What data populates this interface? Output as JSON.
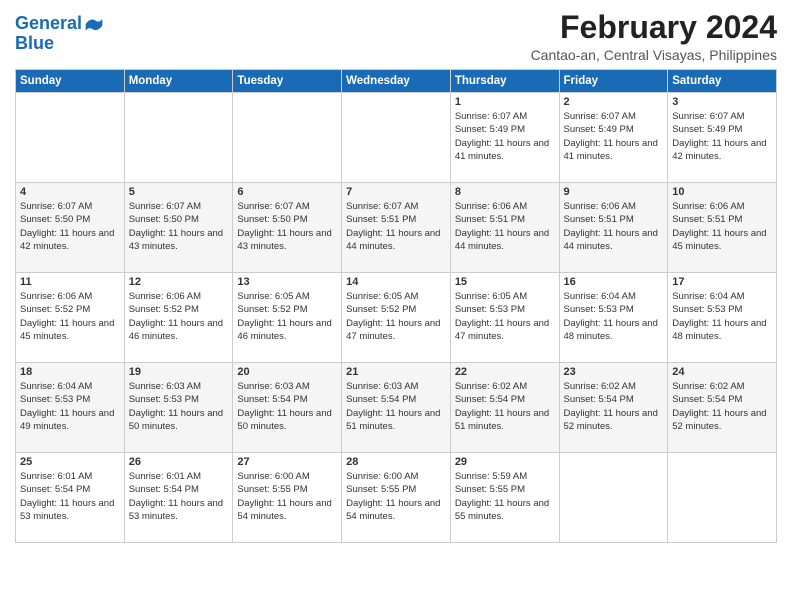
{
  "logo": {
    "line1": "General",
    "line2": "Blue"
  },
  "title": "February 2024",
  "subtitle": "Cantao-an, Central Visayas, Philippines",
  "days_header": [
    "Sunday",
    "Monday",
    "Tuesday",
    "Wednesday",
    "Thursday",
    "Friday",
    "Saturday"
  ],
  "weeks": [
    [
      {
        "day": "",
        "info": ""
      },
      {
        "day": "",
        "info": ""
      },
      {
        "day": "",
        "info": ""
      },
      {
        "day": "",
        "info": ""
      },
      {
        "day": "1",
        "info": "Sunrise: 6:07 AM\nSunset: 5:49 PM\nDaylight: 11 hours and 41 minutes."
      },
      {
        "day": "2",
        "info": "Sunrise: 6:07 AM\nSunset: 5:49 PM\nDaylight: 11 hours and 41 minutes."
      },
      {
        "day": "3",
        "info": "Sunrise: 6:07 AM\nSunset: 5:49 PM\nDaylight: 11 hours and 42 minutes."
      }
    ],
    [
      {
        "day": "4",
        "info": "Sunrise: 6:07 AM\nSunset: 5:50 PM\nDaylight: 11 hours and 42 minutes."
      },
      {
        "day": "5",
        "info": "Sunrise: 6:07 AM\nSunset: 5:50 PM\nDaylight: 11 hours and 43 minutes."
      },
      {
        "day": "6",
        "info": "Sunrise: 6:07 AM\nSunset: 5:50 PM\nDaylight: 11 hours and 43 minutes."
      },
      {
        "day": "7",
        "info": "Sunrise: 6:07 AM\nSunset: 5:51 PM\nDaylight: 11 hours and 44 minutes."
      },
      {
        "day": "8",
        "info": "Sunrise: 6:06 AM\nSunset: 5:51 PM\nDaylight: 11 hours and 44 minutes."
      },
      {
        "day": "9",
        "info": "Sunrise: 6:06 AM\nSunset: 5:51 PM\nDaylight: 11 hours and 44 minutes."
      },
      {
        "day": "10",
        "info": "Sunrise: 6:06 AM\nSunset: 5:51 PM\nDaylight: 11 hours and 45 minutes."
      }
    ],
    [
      {
        "day": "11",
        "info": "Sunrise: 6:06 AM\nSunset: 5:52 PM\nDaylight: 11 hours and 45 minutes."
      },
      {
        "day": "12",
        "info": "Sunrise: 6:06 AM\nSunset: 5:52 PM\nDaylight: 11 hours and 46 minutes."
      },
      {
        "day": "13",
        "info": "Sunrise: 6:05 AM\nSunset: 5:52 PM\nDaylight: 11 hours and 46 minutes."
      },
      {
        "day": "14",
        "info": "Sunrise: 6:05 AM\nSunset: 5:52 PM\nDaylight: 11 hours and 47 minutes."
      },
      {
        "day": "15",
        "info": "Sunrise: 6:05 AM\nSunset: 5:53 PM\nDaylight: 11 hours and 47 minutes."
      },
      {
        "day": "16",
        "info": "Sunrise: 6:04 AM\nSunset: 5:53 PM\nDaylight: 11 hours and 48 minutes."
      },
      {
        "day": "17",
        "info": "Sunrise: 6:04 AM\nSunset: 5:53 PM\nDaylight: 11 hours and 48 minutes."
      }
    ],
    [
      {
        "day": "18",
        "info": "Sunrise: 6:04 AM\nSunset: 5:53 PM\nDaylight: 11 hours and 49 minutes."
      },
      {
        "day": "19",
        "info": "Sunrise: 6:03 AM\nSunset: 5:53 PM\nDaylight: 11 hours and 50 minutes."
      },
      {
        "day": "20",
        "info": "Sunrise: 6:03 AM\nSunset: 5:54 PM\nDaylight: 11 hours and 50 minutes."
      },
      {
        "day": "21",
        "info": "Sunrise: 6:03 AM\nSunset: 5:54 PM\nDaylight: 11 hours and 51 minutes."
      },
      {
        "day": "22",
        "info": "Sunrise: 6:02 AM\nSunset: 5:54 PM\nDaylight: 11 hours and 51 minutes."
      },
      {
        "day": "23",
        "info": "Sunrise: 6:02 AM\nSunset: 5:54 PM\nDaylight: 11 hours and 52 minutes."
      },
      {
        "day": "24",
        "info": "Sunrise: 6:02 AM\nSunset: 5:54 PM\nDaylight: 11 hours and 52 minutes."
      }
    ],
    [
      {
        "day": "25",
        "info": "Sunrise: 6:01 AM\nSunset: 5:54 PM\nDaylight: 11 hours and 53 minutes."
      },
      {
        "day": "26",
        "info": "Sunrise: 6:01 AM\nSunset: 5:54 PM\nDaylight: 11 hours and 53 minutes."
      },
      {
        "day": "27",
        "info": "Sunrise: 6:00 AM\nSunset: 5:55 PM\nDaylight: 11 hours and 54 minutes."
      },
      {
        "day": "28",
        "info": "Sunrise: 6:00 AM\nSunset: 5:55 PM\nDaylight: 11 hours and 54 minutes."
      },
      {
        "day": "29",
        "info": "Sunrise: 5:59 AM\nSunset: 5:55 PM\nDaylight: 11 hours and 55 minutes."
      },
      {
        "day": "",
        "info": ""
      },
      {
        "day": "",
        "info": ""
      }
    ]
  ]
}
